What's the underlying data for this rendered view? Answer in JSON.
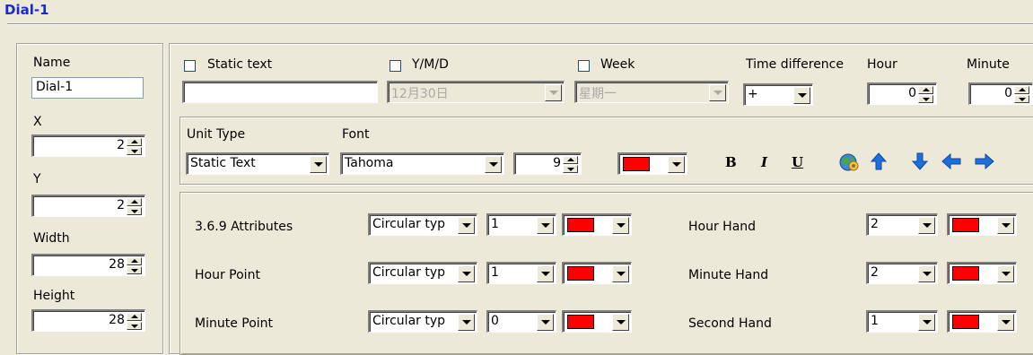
{
  "window": {
    "title": "Dial-1"
  },
  "left": {
    "name_label": "Name",
    "name_value": "Dial-1",
    "x_label": "X",
    "x_value": "2",
    "y_label": "Y",
    "y_value": "2",
    "width_label": "Width",
    "width_value": "28",
    "height_label": "Height",
    "height_value": "28"
  },
  "row1": {
    "static_text_label": "Static text",
    "static_text_value": "",
    "ymd_label": "Y/M/D",
    "ymd_value": "12月30日",
    "week_label": "Week",
    "week_value": "星期一",
    "time_diff_label": "Time difference",
    "time_diff_value": "+",
    "hour_label": "Hour",
    "hour_value": "0",
    "minute_label": "Minute",
    "minute_value": "0"
  },
  "row2": {
    "unit_type_label": "Unit Type",
    "unit_type_value": "Static Text",
    "font_label": "Font",
    "font_value": "Tahoma",
    "font_size": "9",
    "font_color": "#ff0000",
    "bold_label": "B",
    "italic_label": "I",
    "underline_label": "U"
  },
  "attributes": {
    "rows": [
      {
        "label": "3.6.9 Attributes",
        "type": "Circular typ",
        "num": "1",
        "color": "#ff0000",
        "hand_label": "Hour Hand",
        "hand_num": "2",
        "hand_color": "#ff0000"
      },
      {
        "label": "Hour Point",
        "type": "Circular typ",
        "num": "1",
        "color": "#ff0000",
        "hand_label": "Minute Hand",
        "hand_num": "2",
        "hand_color": "#ff0000"
      },
      {
        "label": "Minute Point",
        "type": "Circular typ",
        "num": "0",
        "color": "#ff0000",
        "hand_label": "Second Hand",
        "hand_num": "1",
        "hand_color": "#ff0000"
      }
    ]
  },
  "icons": [
    "globe-icon",
    "arrow-up-icon",
    "arrow-down-icon",
    "arrow-left-icon",
    "arrow-right-icon"
  ],
  "colors": {
    "title": "#1a2acc",
    "arrow": "#1e6fd9"
  }
}
